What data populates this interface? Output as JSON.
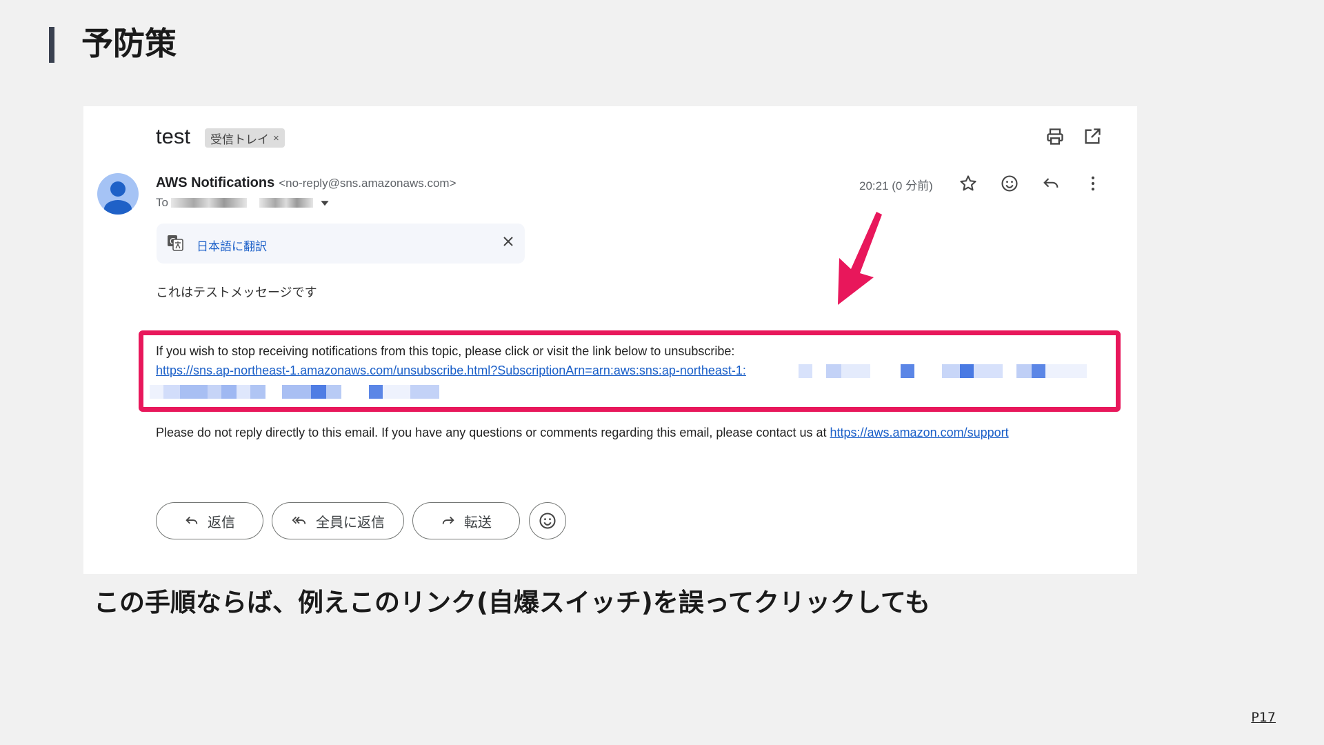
{
  "slide": {
    "title": "予防策",
    "caption": "この手順ならば、例えこのリンク(自爆スイッチ)を誤ってクリックしても",
    "page": "P17",
    "accent_color": "#e8175b"
  },
  "email": {
    "subject": "test",
    "label": "受信トレイ",
    "label_remove": "×",
    "sender_name": "AWS Notifications",
    "sender_email": "<no-reply@sns.amazonaws.com>",
    "to_prefix": "To",
    "timestamp": "20:21 (0 分前)",
    "translate_link": "日本語に翻訳",
    "body": "これはテストメッセージです",
    "unsubscribe_text": "If you wish to stop receiving notifications from this topic, please click or visit the link below to unsubscribe:",
    "unsubscribe_link": "https://sns.ap-northeast-1.amazonaws.com/unsubscribe.html?SubscriptionArn=arn:aws:sns:ap-northeast-1:",
    "footer_text": "Please do not reply directly to this email. If you have any questions or comments regarding this email, please contact us at ",
    "footer_link": "https://aws.amazon.com/support"
  },
  "actions": {
    "reply": "返信",
    "reply_all": "全員に返信",
    "forward": "転送"
  },
  "icons": [
    "print-icon",
    "open-in-new-window-icon",
    "avatar-icon",
    "star-icon",
    "emoji-icon",
    "reply-icon",
    "more-vert-icon",
    "translate-icon",
    "close-icon",
    "arrow-pointer"
  ]
}
